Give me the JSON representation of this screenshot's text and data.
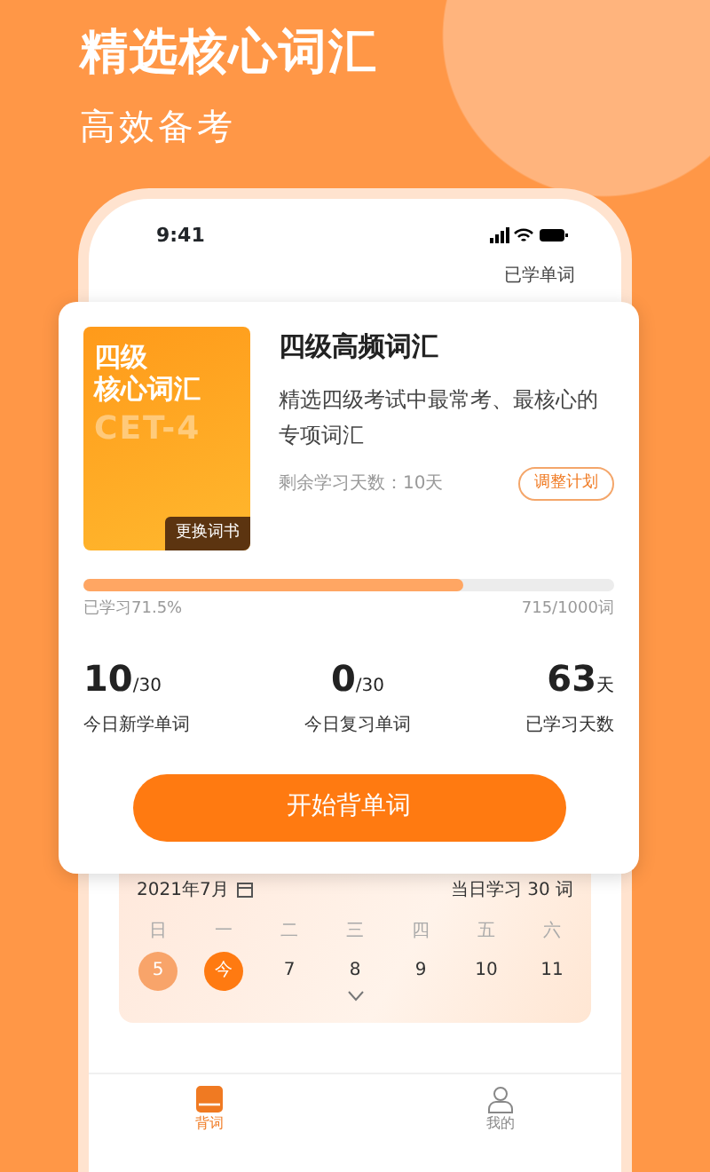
{
  "promo": {
    "title": "精选核心词汇",
    "subtitle": "高效备考"
  },
  "status_bar": {
    "time": "9:41"
  },
  "header_link": "已学单词",
  "book": {
    "cover_lines": [
      "四级",
      "核心词汇",
      "CET-4"
    ],
    "change_button": "更换词书",
    "title": "四级高频词汇",
    "description": "精选四级考试中最常考、最核心的专项词汇",
    "remaining": "剩余学习天数：10天",
    "adjust_button": "调整计划"
  },
  "progress": {
    "level": 0.715,
    "learned": "已学习71.5%",
    "count": "715/1000词"
  },
  "stats": [
    {
      "value": "10",
      "unit": "/30",
      "label": "今日新学单词"
    },
    {
      "value": "0",
      "unit": "/30",
      "label": "今日复习单词"
    },
    {
      "value": "63",
      "unit": "天",
      "label": "已学习天数"
    }
  ],
  "start_button": "开始背单词",
  "calendar": {
    "month": "2021年7月",
    "goal": "当日学习 30 词",
    "weekdays": [
      "日",
      "一",
      "二",
      "三",
      "四",
      "五",
      "六"
    ],
    "days": [
      {
        "label": "5",
        "kind": "done"
      },
      {
        "label": "今",
        "kind": "today"
      },
      {
        "label": "7",
        "kind": "plain"
      },
      {
        "label": "8",
        "kind": "plain"
      },
      {
        "label": "9",
        "kind": "plain"
      },
      {
        "label": "10",
        "kind": "plain"
      },
      {
        "label": "11",
        "kind": "plain"
      }
    ]
  },
  "tabs": [
    {
      "label": "背词",
      "selected": true
    },
    {
      "label": "我的",
      "selected": false
    }
  ]
}
